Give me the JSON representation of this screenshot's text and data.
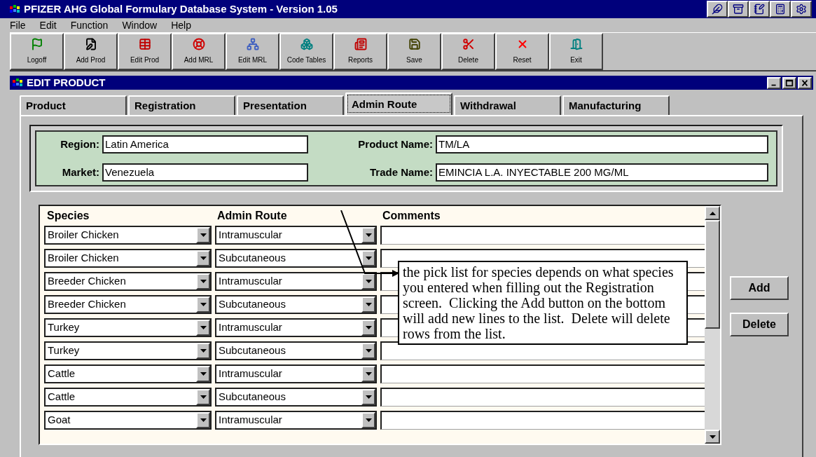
{
  "window": {
    "title": "PFIZER AHG Global Formulary Database System - Version 1.05"
  },
  "menu": [
    "File",
    "Edit",
    "Function",
    "Window",
    "Help"
  ],
  "toolbar": [
    "Logoff",
    "Add Prod",
    "Edit Prod",
    "Add MRL",
    "Edit MRL",
    "Code Tables",
    "Reports",
    "Save",
    "Delete",
    "Reset",
    "Exit"
  ],
  "child_window": {
    "title": "EDIT PRODUCT"
  },
  "tabs": [
    {
      "label": "Product",
      "selected": false
    },
    {
      "label": "Registration",
      "selected": false
    },
    {
      "label": "Presentation",
      "selected": false
    },
    {
      "label": "Admin Route",
      "selected": true
    },
    {
      "label": "Withdrawal",
      "selected": false
    },
    {
      "label": "Manufacturing",
      "selected": false
    }
  ],
  "header": {
    "region": {
      "label": "Region:",
      "value": "Latin America"
    },
    "market": {
      "label": "Market:",
      "value": "Venezuela"
    },
    "product_name": {
      "label": "Product Name:",
      "value": "TM/LA"
    },
    "trade_name": {
      "label": "Trade Name:",
      "value": "EMINCIA L.A. INYECTABLE 200 MG/ML"
    }
  },
  "table": {
    "columns": [
      "Species",
      "Admin Route",
      "Comments"
    ],
    "rows": [
      {
        "species": "Broiler Chicken",
        "route": "Intramuscular"
      },
      {
        "species": "Broiler Chicken",
        "route": "Subcutaneous"
      },
      {
        "species": "Breeder Chicken",
        "route": "Intramuscular"
      },
      {
        "species": "Breeder Chicken",
        "route": "Subcutaneous"
      },
      {
        "species": "Turkey",
        "route": "Intramuscular"
      },
      {
        "species": "Turkey",
        "route": "Subcutaneous"
      },
      {
        "species": "Cattle",
        "route": "Intramuscular"
      },
      {
        "species": "Cattle",
        "route": "Subcutaneous"
      },
      {
        "species": "Goat",
        "route": "Intramuscular"
      }
    ]
  },
  "buttons": [
    "Add",
    "Delete"
  ],
  "annotation": {
    "text": "the pick list for species depends on what species you entered when filling out the Registration screen.  Clicking the Add button on the bottom  will add new lines to the list.  Delete will delete rows from the list."
  }
}
